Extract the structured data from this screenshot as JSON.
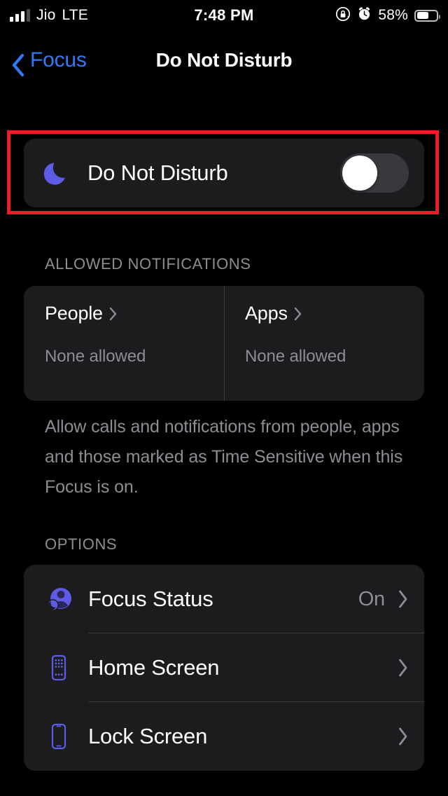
{
  "status_bar": {
    "carrier": "Jio",
    "network": "LTE",
    "time": "7:48 PM",
    "battery_percent": "58%",
    "signal_icon": "signal-bars-icon",
    "rotation_lock_icon": "rotation-lock-icon",
    "alarm_icon": "alarm-clock-icon",
    "battery_icon": "battery-icon"
  },
  "nav": {
    "back_label": "Focus",
    "back_icon": "chevron-left-icon",
    "title": "Do Not Disturb"
  },
  "dnd": {
    "icon": "moon-icon",
    "label": "Do Not Disturb",
    "toggle_state": "off",
    "highlighted": true
  },
  "allowed": {
    "header": "ALLOWED NOTIFICATIONS",
    "columns": [
      {
        "title": "People",
        "value": "None allowed",
        "chevron_icon": "chevron-right-icon"
      },
      {
        "title": "Apps",
        "value": "None allowed",
        "chevron_icon": "chevron-right-icon"
      }
    ],
    "footer": "Allow calls and notifications from people, apps and those marked as Time Sensitive when this Focus is on."
  },
  "options": {
    "header": "OPTIONS",
    "rows": [
      {
        "icon": "focus-status-person-moon-icon",
        "label": "Focus Status",
        "value": "On",
        "chevron_icon": "chevron-right-icon"
      },
      {
        "icon": "home-screen-icon",
        "label": "Home Screen",
        "value": "",
        "chevron_icon": "chevron-right-icon"
      },
      {
        "icon": "lock-screen-icon",
        "label": "Lock Screen",
        "value": "",
        "chevron_icon": "chevron-right-icon"
      }
    ]
  },
  "colors": {
    "background": "#000000",
    "card": "#1C1C1E",
    "accent_purple": "#5E5CE6",
    "accent_blue": "#2F7BF6",
    "secondary_text": "#8D8D93",
    "separator": "#3A3A3C",
    "highlight_red": "#EE1C25",
    "toggle_track_off": "#39393D"
  }
}
